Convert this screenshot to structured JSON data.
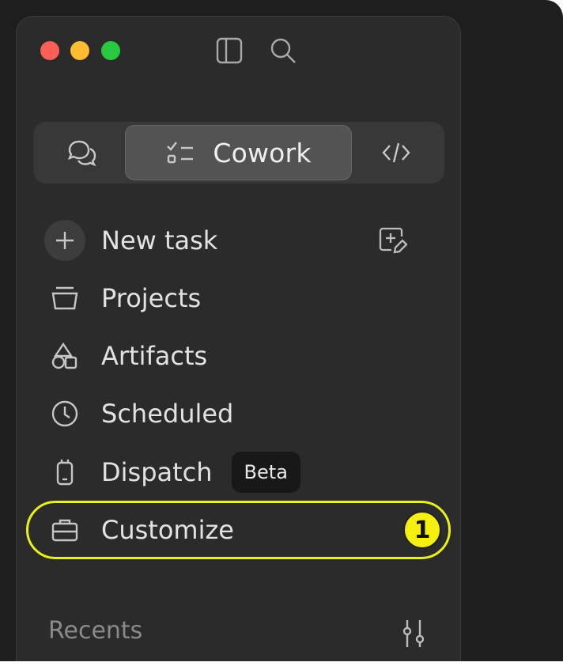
{
  "window": {
    "traffic_lights": {
      "close": "#ff5f57",
      "minimize": "#febc2e",
      "zoom": "#28c840"
    },
    "toolbar_icons": [
      "sidebar-toggle-icon",
      "search-icon"
    ]
  },
  "mode_tabs": [
    {
      "id": "chat",
      "icon": "chat-bubbles-icon",
      "label": ""
    },
    {
      "id": "cowork",
      "icon": "checklist-icon",
      "label": "Cowork",
      "active": true
    },
    {
      "id": "code",
      "icon": "code-brackets-icon",
      "label": ""
    }
  ],
  "nav": {
    "new_task": "New task",
    "projects": "Projects",
    "artifacts": "Artifacts",
    "scheduled": "Scheduled",
    "dispatch": "Dispatch",
    "dispatch_badge": "Beta",
    "customize": "Customize"
  },
  "annotation": {
    "step_number": "1",
    "color": "#f6f00f"
  },
  "recents": {
    "label": "Recents"
  }
}
